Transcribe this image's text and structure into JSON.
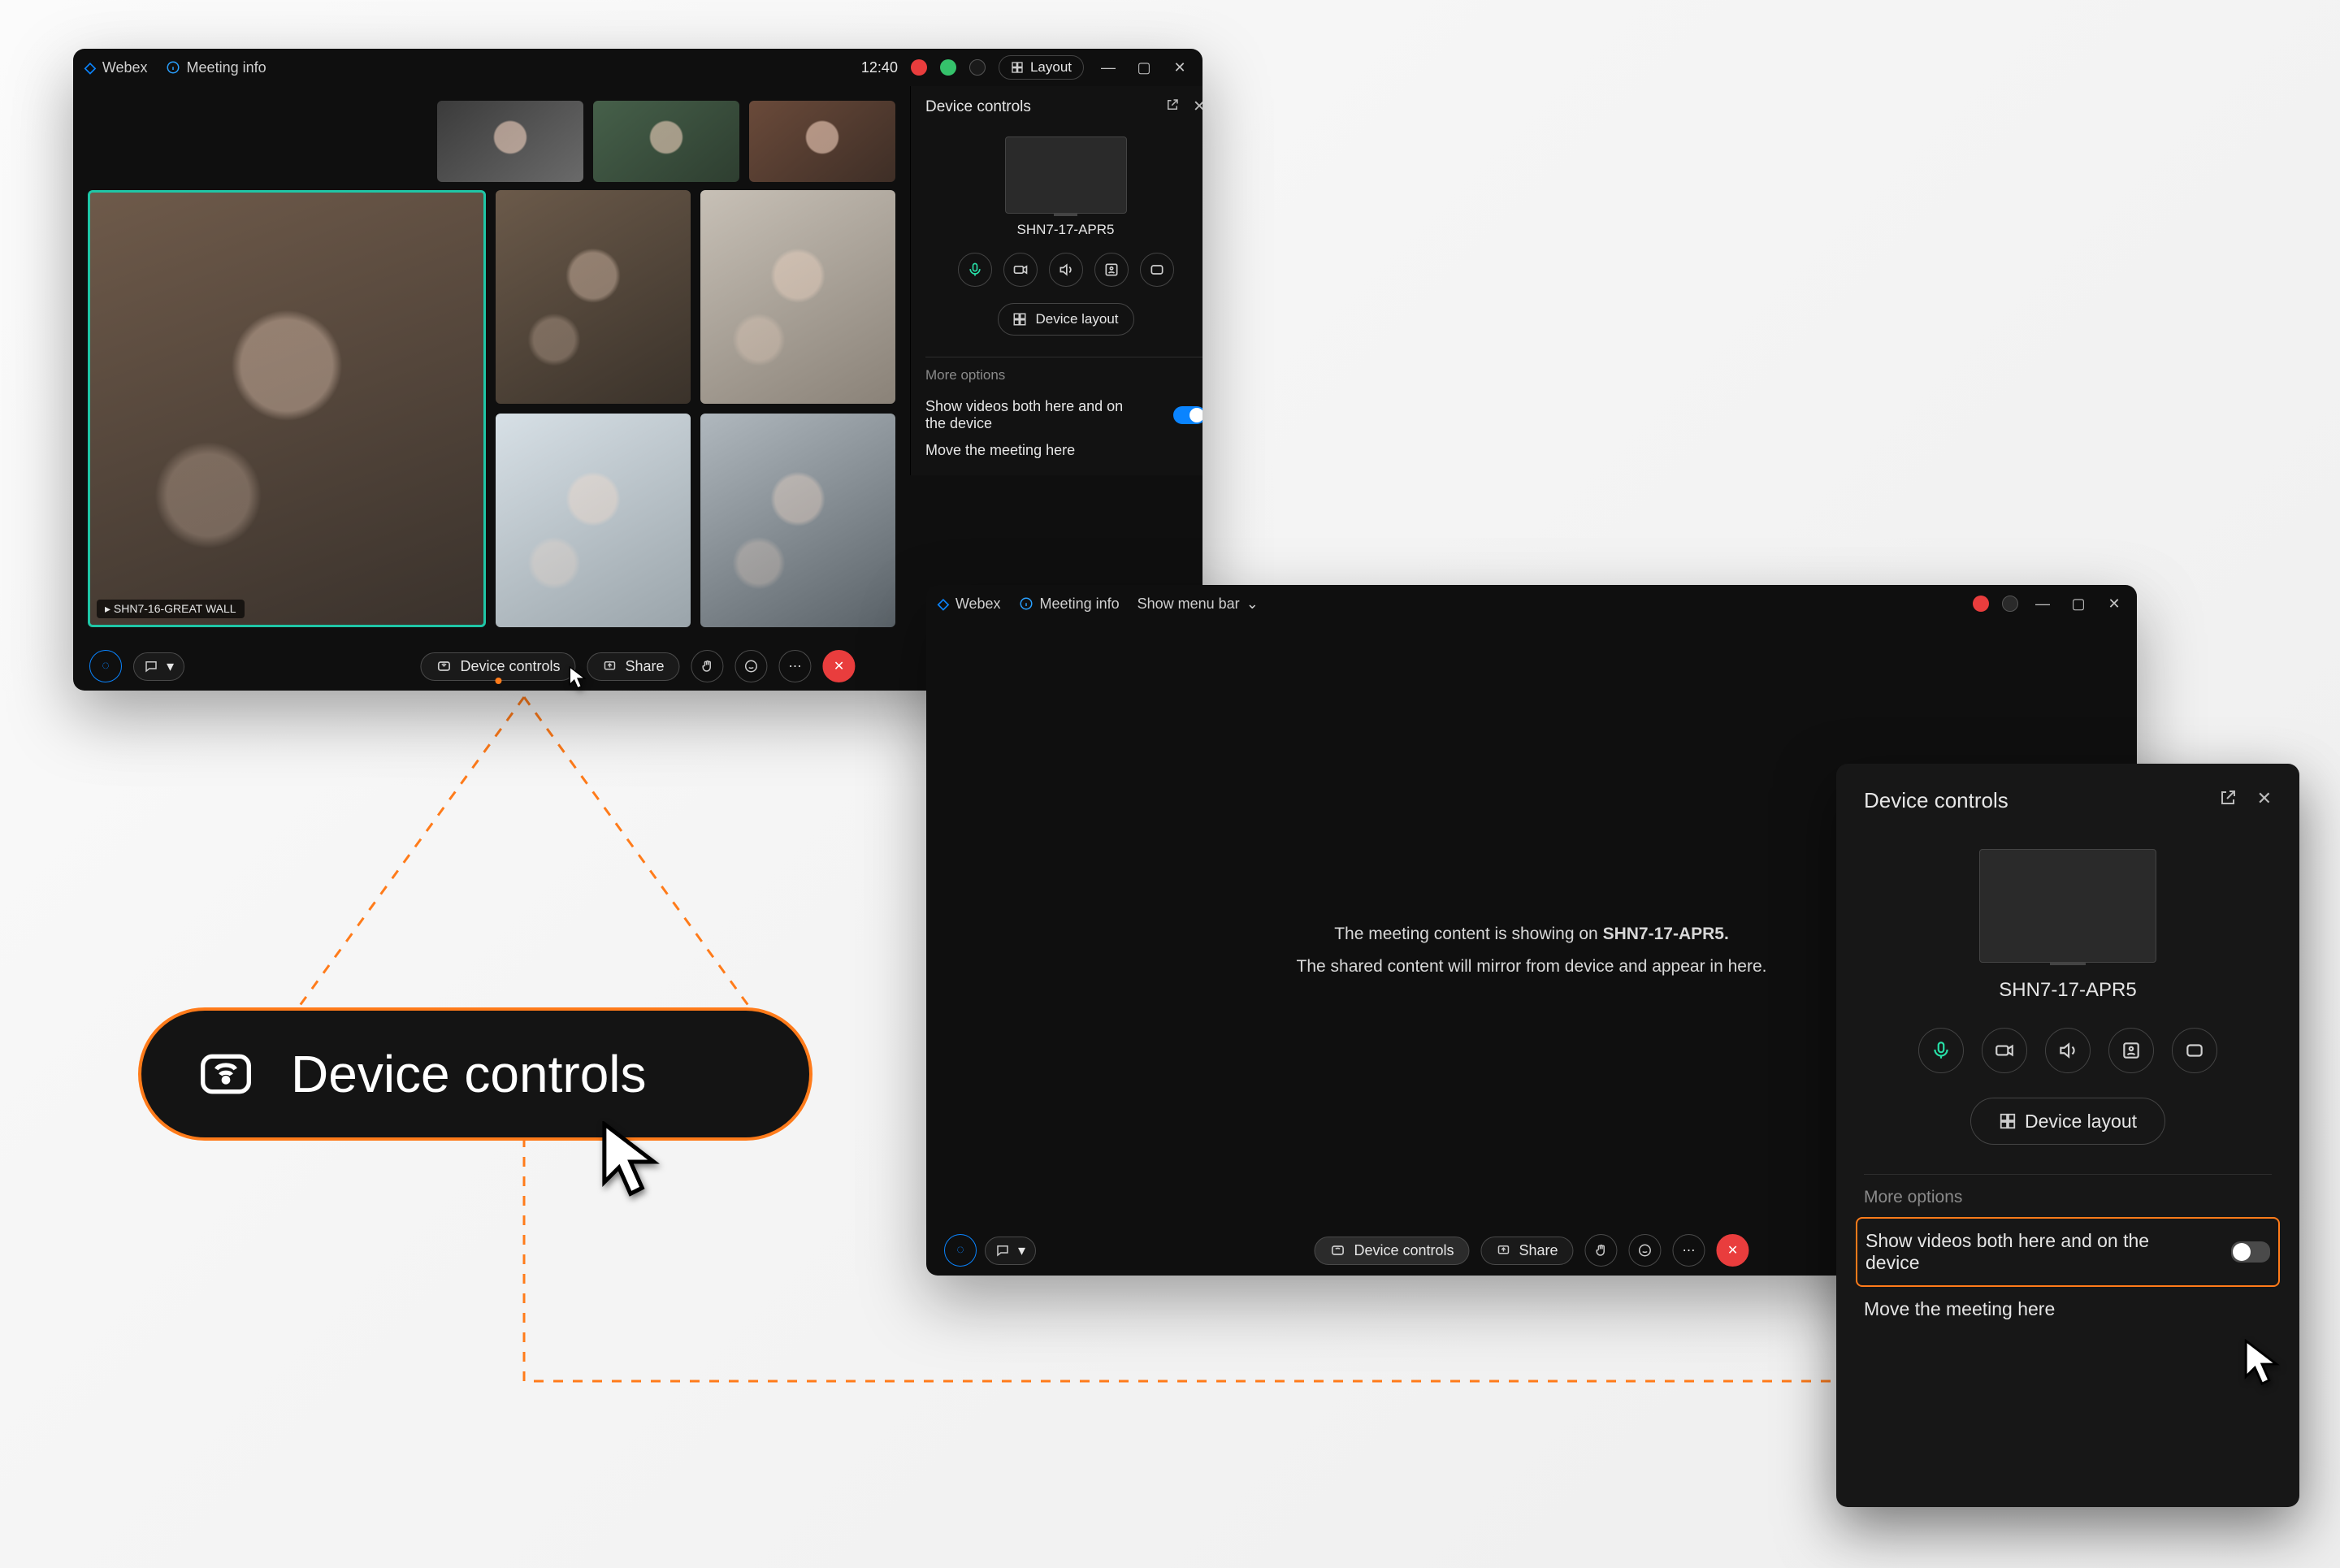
{
  "app": {
    "name": "Webex",
    "meeting_info_label": "Meeting info",
    "show_menu_bar_label": "Show menu bar"
  },
  "header": {
    "time": "12:40",
    "layout_label": "Layout"
  },
  "room_label": "SHN7-16-GREAT WALL",
  "panel": {
    "title": "Device controls",
    "device_name": "SHN7-17-APR5",
    "device_layout_label": "Device layout",
    "more_options_label": "More options",
    "show_videos_label": "Show videos both here and on the device",
    "move_here_label": "Move the meeting here"
  },
  "toolbar": {
    "device_controls_label": "Device controls",
    "share_label": "Share"
  },
  "win2": {
    "msg_line1_a": "The meeting content is showing on ",
    "msg_line1_b": "SHN7-17-APR5.",
    "msg_line2": "The shared content will mirror from device and appear in here."
  },
  "callout": {
    "label": "Device controls"
  }
}
